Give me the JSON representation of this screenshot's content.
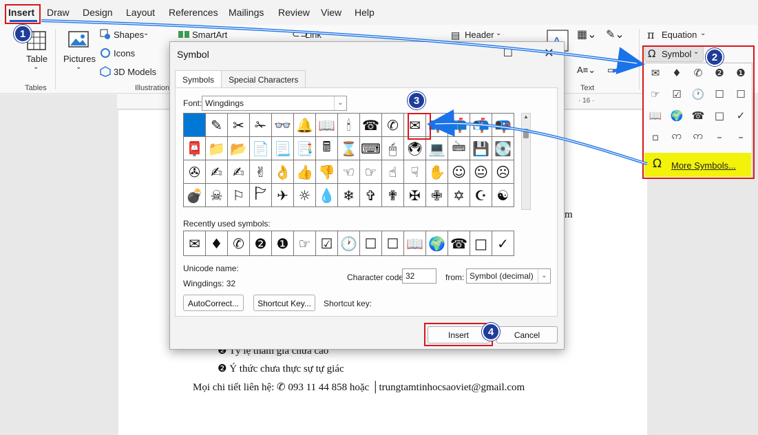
{
  "menu": {
    "tabs": [
      "Insert",
      "Draw",
      "Design",
      "Layout",
      "References",
      "Mailings",
      "Review",
      "View",
      "Help"
    ]
  },
  "ribbon": {
    "table": "Table",
    "tables_group": "Tables",
    "pictures": "Pictures",
    "shapes": "Shapes",
    "icons": "Icons",
    "models": "3D Models",
    "illustrations_group": "Illustration",
    "smartart": "SmartArt",
    "link": "Link",
    "header": "Header",
    "text_group": "Text",
    "equation": "Equation",
    "symbol": "Symbol"
  },
  "dialog": {
    "title": "Symbol",
    "tab_symbols": "Symbols",
    "tab_special": "Special Characters",
    "font_label": "Font:",
    "font_value": "Wingdings",
    "symbols_rows": [
      [
        "",
        "✎",
        "✂",
        "✁",
        "👓",
        "🔔",
        "📖",
        "🕯",
        "☎",
        "✆",
        "✉",
        "📪",
        "📫",
        "📬",
        "📭"
      ],
      [
        "📮",
        "📁",
        "📂",
        "📄",
        "📃",
        "📑",
        "🖩",
        "⌛",
        "⌨",
        "🖱",
        "🖲",
        "💻",
        "🖮",
        "💾",
        "💽"
      ],
      [
        "✇",
        "✍",
        "✍",
        "✌",
        "👌",
        "👍",
        "👎",
        "☜",
        "☞",
        "☝",
        "☟",
        "✋",
        "☺",
        "😐",
        "☹"
      ],
      [
        "💣",
        "☠",
        "⚐",
        "🏱",
        "✈",
        "☼",
        "💧",
        "❄",
        "✞",
        "✟",
        "✠",
        "✙",
        "✡",
        "☪",
        "☯"
      ]
    ],
    "recent_label": "Recently used symbols:",
    "recent": [
      "✉",
      "♦",
      "✆",
      "❷",
      "❶",
      "☞",
      "☑",
      "🕐",
      "☐",
      "☐",
      "📖",
      "🌍",
      "☎",
      "□",
      "✓"
    ],
    "unicode_name_label": "Unicode name:",
    "unicode_name_value": "Wingdings: 32",
    "char_code_label": "Character code:",
    "char_code_value": "32",
    "from_label": "from:",
    "from_value": "Symbol (decimal)",
    "autocorrect": "AutoCorrect...",
    "shortcut_key_btn": "Shortcut Key...",
    "shortcut_key_label": "Shortcut key:",
    "insert": "Insert",
    "cancel": "Cancel"
  },
  "symbol_panel": {
    "cells": [
      "✉",
      "♦",
      "✆",
      "❷",
      "❶",
      "☞",
      "☑",
      "🕐",
      "☐",
      "☐",
      "📖",
      "🌍",
      "☎",
      "□",
      "✓",
      "▫",
      "ဢ",
      "ဢ",
      "–",
      "–"
    ],
    "more": "More Symbols..."
  },
  "document": {
    "line_m": "m",
    "line1": "❷ Tỷ lệ tham gia chưa cao",
    "line2": "❷ Ý thức chưa thực sự tự giác",
    "line3": "Mọi chi tiết liên hệ: ✆ 093 11 44 858 hoặc │trungtamtinhocsaoviet@gmail.com"
  },
  "steps": [
    "1",
    "2",
    "3",
    "4"
  ],
  "colors": {
    "annotation_red": "#d9151b",
    "badge_blue": "#1f3d99",
    "arrow_blue": "#1a73e8",
    "selected": "#0078d4",
    "highlight": "#f2f20a"
  }
}
